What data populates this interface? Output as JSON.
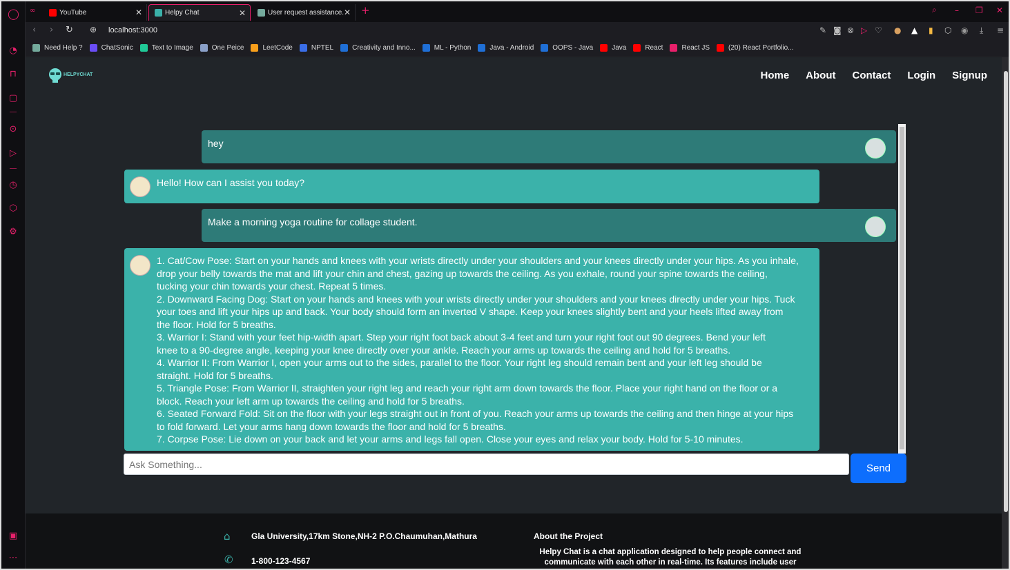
{
  "browser": {
    "tabs": [
      {
        "label": "YouTube",
        "color": "#ff0000"
      },
      {
        "label": "Helpy Chat",
        "color": "#3bb2aa"
      },
      {
        "label": "User request assistance.",
        "color": "#74aa9c"
      }
    ],
    "new_tab": "+",
    "url": "localhost:3000"
  },
  "bookmarks": [
    {
      "label": "Need Help ?",
      "color": "#74aa9c"
    },
    {
      "label": "ChatSonic",
      "color": "#6a4df5"
    },
    {
      "label": "Text to Image",
      "color": "#20c997"
    },
    {
      "label": "One Peice",
      "color": "#8aa0c8"
    },
    {
      "label": "LeetCode",
      "color": "#f89f1b"
    },
    {
      "label": "NPTEL",
      "color": "#3a6ee8"
    },
    {
      "label": "Creativity and Inno...",
      "color": "#1f6fd6"
    },
    {
      "label": "ML - Python",
      "color": "#1f6fd6"
    },
    {
      "label": "Java - Android",
      "color": "#1f6fd6"
    },
    {
      "label": "OOPS - Java",
      "color": "#1f6fd6"
    },
    {
      "label": "Java",
      "color": "#ff0000"
    },
    {
      "label": "React",
      "color": "#ff0000"
    },
    {
      "label": "React JS",
      "color": "#e8206b"
    },
    {
      "label": "(20) React Portfolio...",
      "color": "#ff0000"
    }
  ],
  "app": {
    "logo_text": "HELPYCHAT",
    "nav": [
      "Home",
      "About",
      "Contact",
      "Login",
      "Signup"
    ]
  },
  "chat": {
    "messages": [
      {
        "role": "user",
        "text": "hey"
      },
      {
        "role": "bot",
        "text": "Hello! How can I assist you today?"
      },
      {
        "role": "user",
        "text": "Make a morning yoga routine for collage student."
      },
      {
        "role": "bot",
        "lines": [
          "1. Cat/Cow Pose: Start on your hands and knees with your wrists directly under your shoulders and your knees directly under your hips. As you inhale,",
          "drop your belly towards the mat and lift your chin and chest, gazing up towards the ceiling. As you exhale, round your spine towards the ceiling,",
          "tucking your chin towards your chest. Repeat 5 times.",
          "2. Downward Facing Dog: Start on your hands and knees with your wrists directly under your shoulders and your knees directly under your hips. Tuck",
          "your toes and lift your hips up and back. Your body should form an inverted V shape. Keep your knees slightly bent and your heels lifted away from",
          "the floor. Hold for 5 breaths.",
          "3. Warrior I: Stand with your feet hip-width apart. Step your right foot back about 3-4 feet and turn your right foot out 90 degrees. Bend your left",
          "knee to a 90-degree angle, keeping your knee directly over your ankle. Reach your arms up towards the ceiling and hold for 5 breaths.",
          "4. Warrior II: From Warrior I, open your arms out to the sides, parallel to the floor. Your right leg should remain bent and your left leg should be",
          "straight. Hold for 5 breaths.",
          "5. Triangle Pose: From Warrior II, straighten your right leg and reach your right arm down towards the floor. Place your right hand on the floor or a",
          "block. Reach your left arm up towards the ceiling and hold for 5 breaths.",
          "6. Seated Forward Fold: Sit on the floor with your legs straight out in front of you. Reach your arms up towards the ceiling and then hinge at your hips",
          "to fold forward. Let your arms hang down towards the floor and hold for 5 breaths.",
          "7. Corpse Pose: Lie down on your back and let your arms and legs fall open. Close your eyes and relax your body. Hold for 5-10 minutes."
        ]
      }
    ],
    "input_placeholder": "Ask Something...",
    "send_label": "Send"
  },
  "footer": {
    "address": "Gla University,17km Stone,NH-2 P.O.Chaumuhan,Mathura",
    "phone": "1-800-123-4567",
    "about_title": "About the Project",
    "about_body": "Helpy Chat is a chat application designed to help people connect and communicate with each other in real-time. Its features include user"
  },
  "icons": {
    "sidebar": [
      "opera-logo-icon",
      "speed-dial-icon",
      "bag-icon",
      "instagram-icon",
      "player-icon",
      "send-icon",
      "history-icon",
      "cube-icon",
      "settings-icon",
      "gallery-icon",
      "more-icon"
    ],
    "footer": [
      "home-icon",
      "phone-icon"
    ]
  },
  "colors": {
    "accent": "#e8206b",
    "user_bubble": "#2e7b78",
    "bot_bubble": "#3bb2aa",
    "send": "#0d6efd",
    "page_bg": "#212529"
  }
}
